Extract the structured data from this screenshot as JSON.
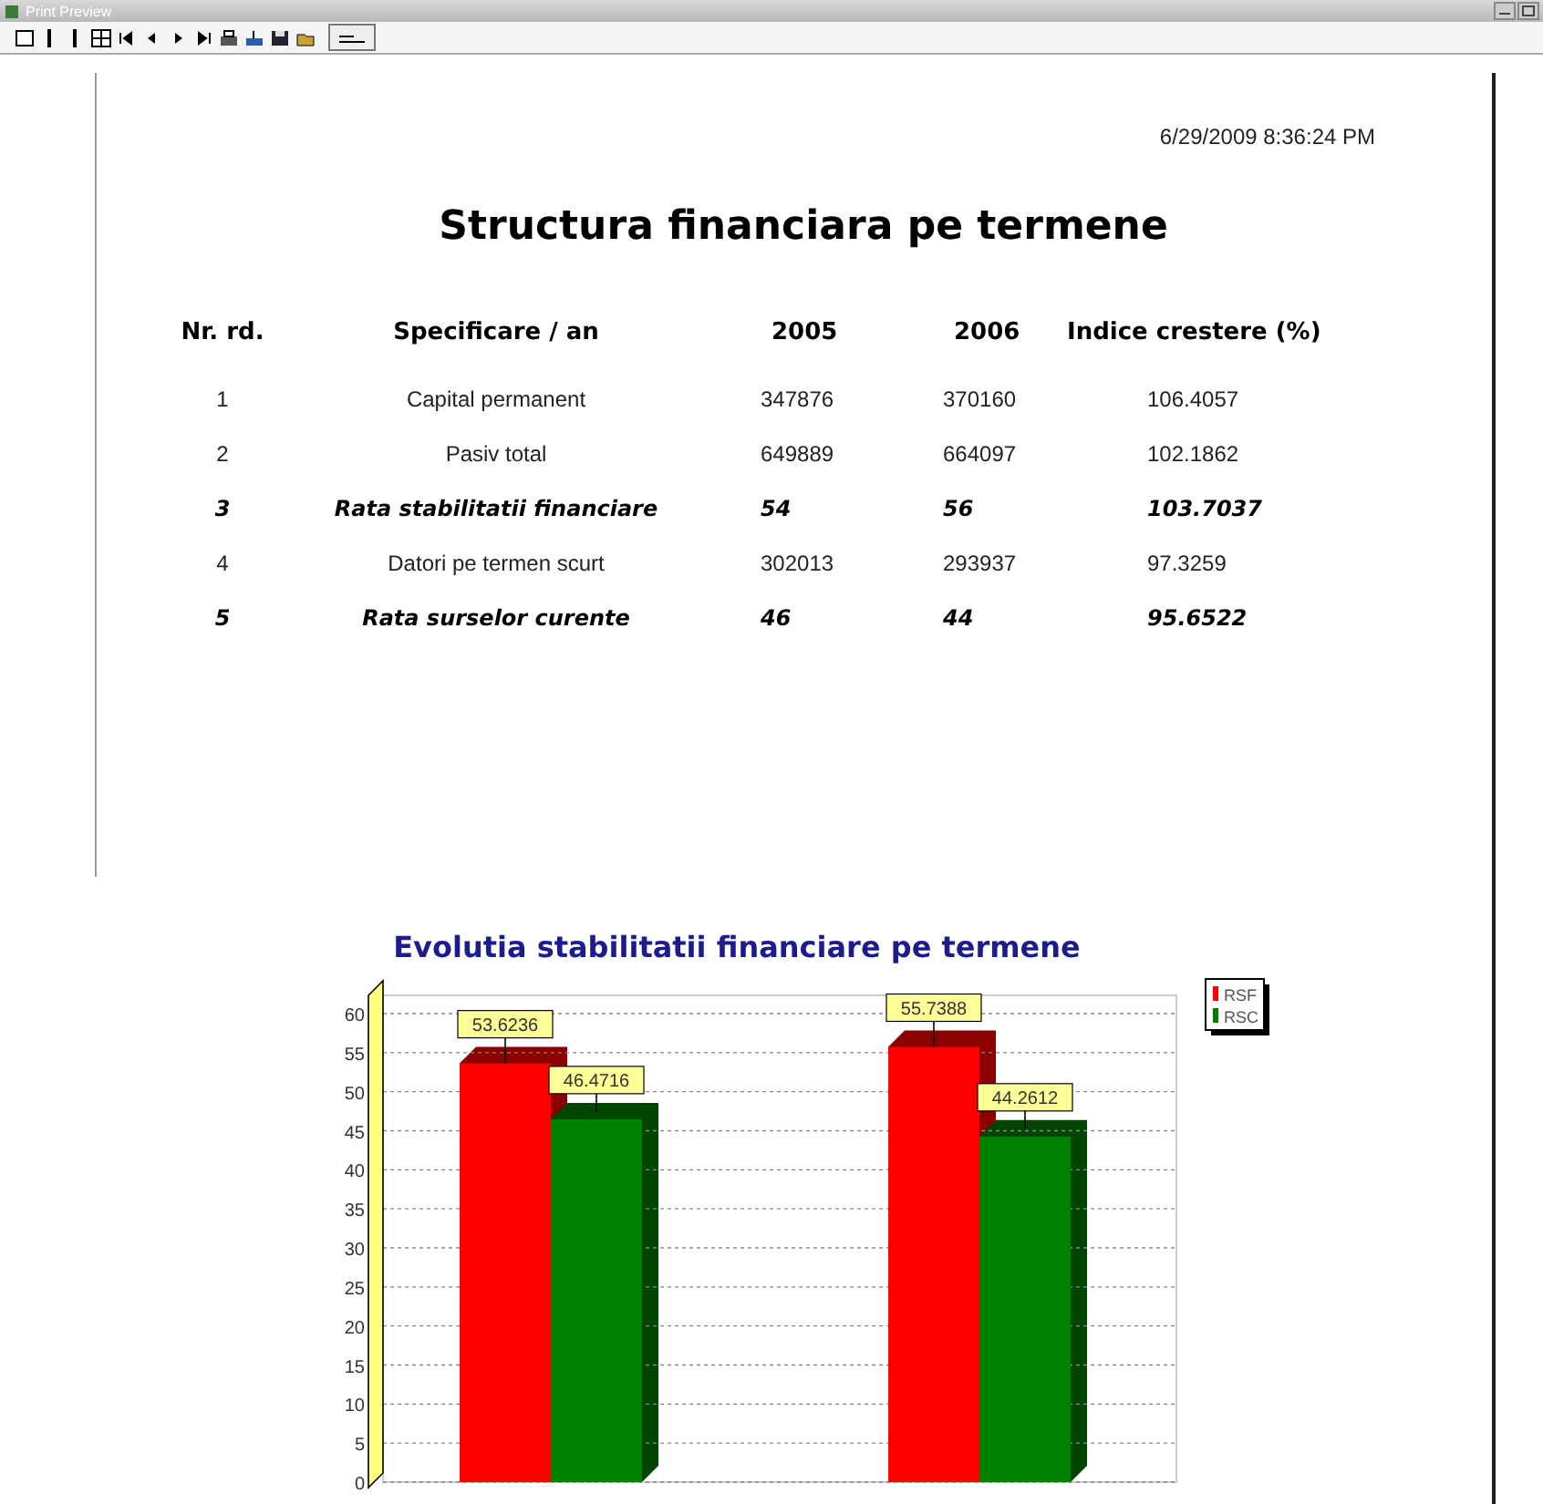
{
  "window": {
    "title": "Print Preview"
  },
  "report": {
    "timestamp": "6/29/2009 8:36:24 PM",
    "title": "Structura financiara pe termene",
    "columns": [
      "Nr. rd.",
      "Specificare / an",
      "2005",
      "2006",
      "Indice crestere (%)"
    ],
    "rows": [
      {
        "kind": "normal",
        "cells": [
          "1",
          "Capital permanent",
          "347876",
          "370160",
          "106.4057"
        ]
      },
      {
        "kind": "normal",
        "cells": [
          "2",
          "Pasiv total",
          "649889",
          "664097",
          "102.1862"
        ]
      },
      {
        "kind": "emphasis",
        "cells": [
          "3",
          "Rata stabilitatii financiare",
          "54",
          "56",
          "103.7037"
        ]
      },
      {
        "kind": "normal",
        "cells": [
          "4",
          "Datori pe termen scurt",
          "302013",
          "293937",
          "97.3259"
        ]
      },
      {
        "kind": "emphasis",
        "cells": [
          "5",
          "Rata surselor curente",
          "46",
          "44",
          "95.6522"
        ]
      }
    ]
  },
  "chart": {
    "chart_data": {
      "type": "bar",
      "title": "Evolutia stabilitatii financiare pe termene",
      "ylim": [
        0,
        60
      ],
      "yticks": [
        0,
        5,
        10,
        15,
        20,
        25,
        30,
        35,
        40,
        45,
        50,
        55,
        60
      ],
      "data_labels": true,
      "grid": true,
      "legend": true,
      "series": [
        {
          "name": "RSF",
          "color": "#ff0000",
          "values": [
            53.6236,
            55.7388
          ],
          "value_labels": [
            "53.6236",
            "55.7388"
          ]
        },
        {
          "name": "RSC",
          "color": "#008000",
          "values": [
            46.4716,
            44.2612
          ],
          "value_labels": [
            "46.4716",
            "44.2612"
          ]
        }
      ]
    }
  }
}
